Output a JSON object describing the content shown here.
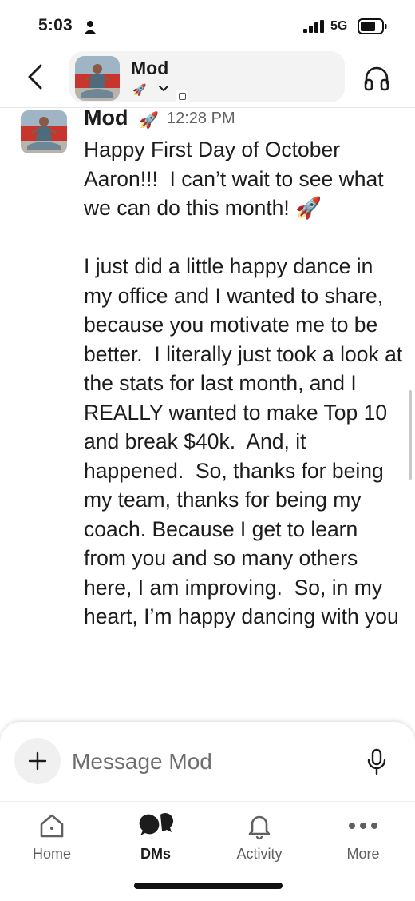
{
  "status_bar": {
    "time": "5:03",
    "network": "5G"
  },
  "header": {
    "channel_name": "Mod",
    "status_emoji": "🚀",
    "icons": [
      "chevron-left-icon",
      "chevron-down-icon",
      "headphones-icon"
    ]
  },
  "message": {
    "author": "Mod",
    "author_emoji": "🚀",
    "time": "12:28 PM",
    "body": "Happy First Day of October Aaron!!!  I can’t wait to see what we can do this month! 🚀\n\nI just did a little happy dance in my office and I wanted to share, because you motivate me to be better.  I literally just took a look at the stats for last month, and I REALLY wanted to make Top 10 and break $40k.  And, it happened.  So, thanks for being my team, thanks for being my coach. Because I get to learn from you and so many others here, I am improving.  So, in my heart, I’m happy dancing with you"
  },
  "composer": {
    "placeholder": "Message Mod",
    "value": ""
  },
  "tabs": [
    {
      "label": "Home",
      "icon": "home-icon",
      "active": false
    },
    {
      "label": "DMs",
      "icon": "dms-icon",
      "active": true
    },
    {
      "label": "Activity",
      "icon": "bell-icon",
      "active": false
    },
    {
      "label": "More",
      "icon": "more-dots-icon",
      "active": false
    }
  ]
}
